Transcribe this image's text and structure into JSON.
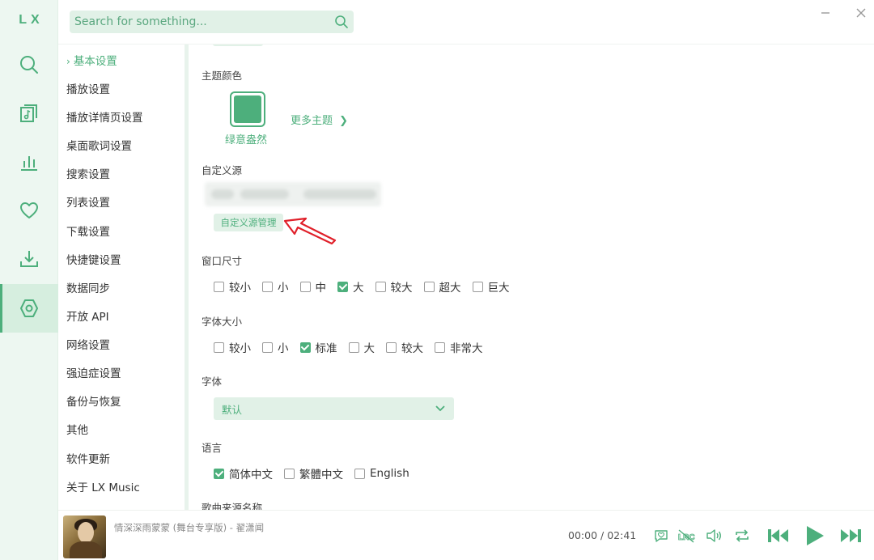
{
  "app": {
    "logo": "LX",
    "accent": "#4daf7c"
  },
  "rail": {
    "items": [
      {
        "name": "search-icon"
      },
      {
        "name": "music-library-icon"
      },
      {
        "name": "leaderboard-icon"
      },
      {
        "name": "heart-icon"
      },
      {
        "name": "download-icon"
      },
      {
        "name": "settings-icon",
        "active": true
      }
    ]
  },
  "search": {
    "placeholder": "Search for something..."
  },
  "settings_nav": {
    "items": [
      "基本设置",
      "播放设置",
      "播放详情页设置",
      "桌面歌词设置",
      "搜索设置",
      "列表设置",
      "下载设置",
      "快捷键设置",
      "数据同步",
      "开放 API",
      "网络设置",
      "强迫症设置",
      "备份与恢复",
      "其他",
      "软件更新",
      "关于 LX Music"
    ],
    "active_index": 0
  },
  "theme": {
    "title": "主题颜色",
    "current_name": "绿意盎然",
    "current_color": "#4daf7c",
    "more_label": "更多主题"
  },
  "custom_source": {
    "title": "自定义源",
    "manage_button": "自定义源管理"
  },
  "window_size": {
    "title": "窗口尺寸",
    "options": [
      "较小",
      "小",
      "中",
      "大",
      "较大",
      "超大",
      "巨大"
    ],
    "selected": "大"
  },
  "font_size": {
    "title": "字体大小",
    "options": [
      "较小",
      "小",
      "标准",
      "大",
      "较大",
      "非常大"
    ],
    "selected": "标准"
  },
  "font": {
    "title": "字体",
    "value": "默认"
  },
  "language": {
    "title": "语言",
    "options": [
      "简体中文",
      "繁體中文",
      "English"
    ],
    "selected": "简体中文"
  },
  "song_source_name": {
    "title": "歌曲来源名称"
  },
  "player": {
    "song": "情深深雨蒙蒙 (舞台专享版) - 翟潇闻",
    "current_time": "00:00",
    "separator": "/",
    "duration": "02:41"
  }
}
